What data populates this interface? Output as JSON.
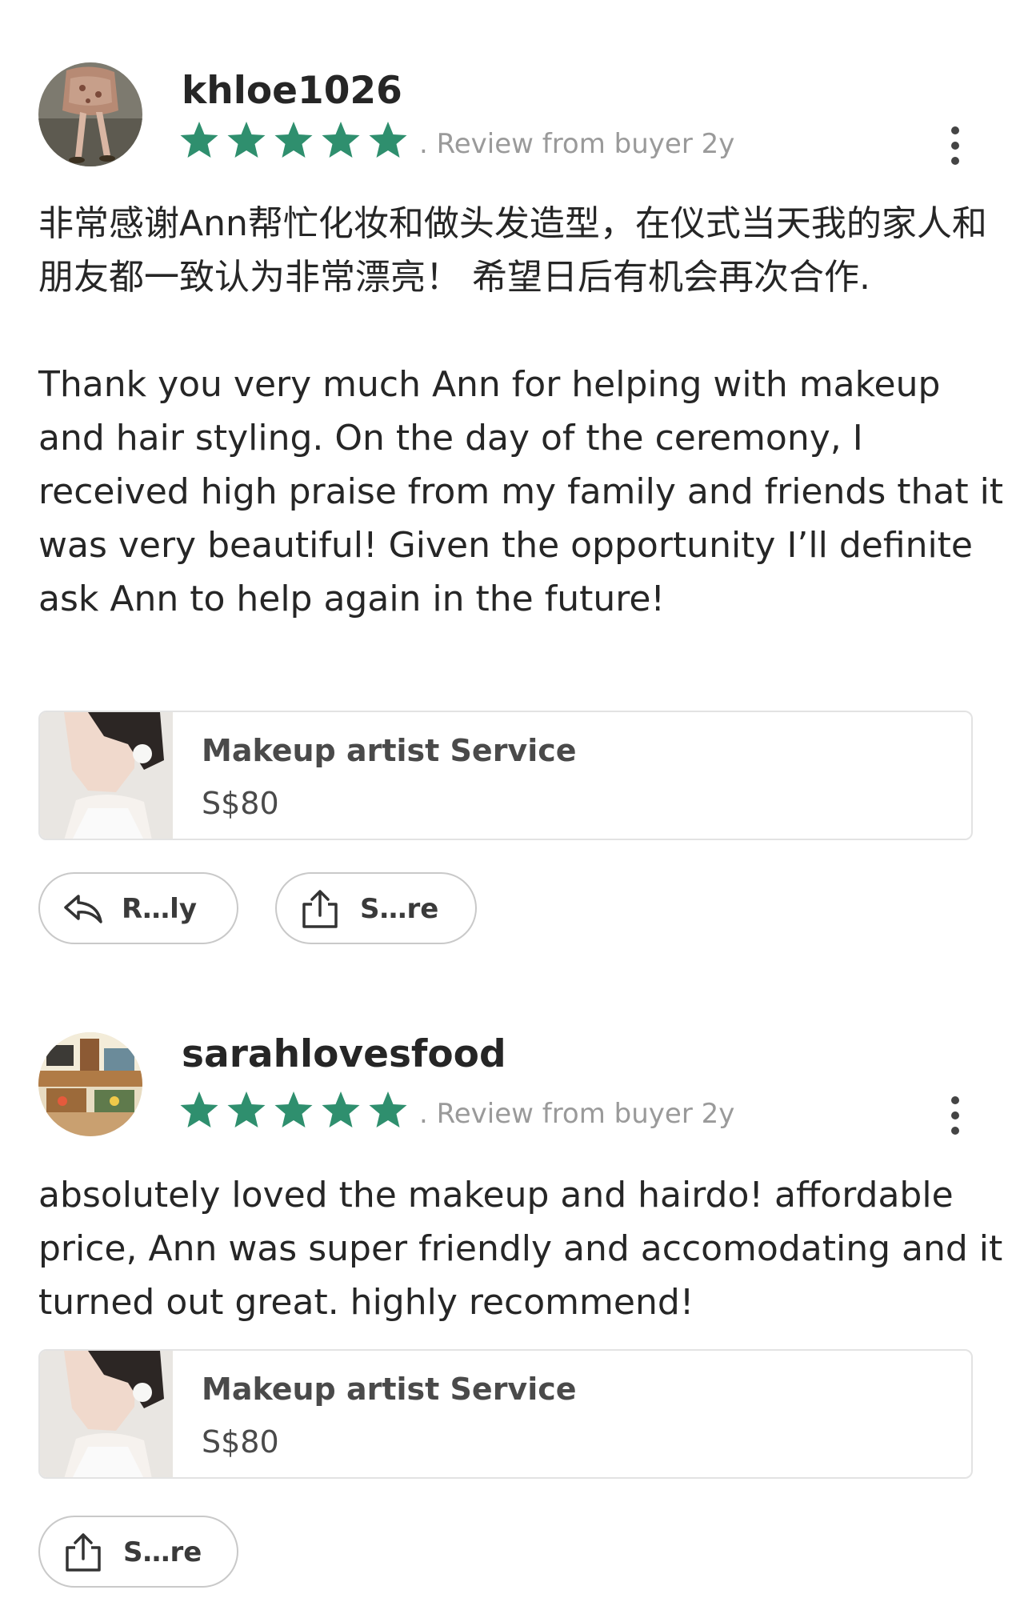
{
  "colors": {
    "star": "#2f8f6e",
    "meta_text": "#9a9a9a",
    "body_text": "#262626",
    "card_border": "#e3e3e3",
    "pill_border": "#c9c9c9"
  },
  "reviews": [
    {
      "username": "khloe1026",
      "rating": 5,
      "meta": ". Review from buyer  2y",
      "body_paragraphs": [
        "非常感谢Ann帮忙化妆和做头发造型，在仪式当天我的家人和朋友都一致认为非常漂亮！ 希望日后有机会再次合作.",
        "Thank you very much Ann for helping with makeup and hair styling. On the day of the ceremony, I received high praise from my family and friends that it was very beautiful! Given the opportunity I’ll definite ask Ann to help again in the future!"
      ],
      "product": {
        "name": "Makeup artist Service",
        "price": "S$80"
      },
      "actions": {
        "reply_label": "R…ly",
        "share_label": "S…re"
      },
      "icons": {
        "avatar": "avatar-photo",
        "more": "more-vertical-icon",
        "reply": "reply-icon",
        "share": "share-icon"
      }
    },
    {
      "username": "sarahlovesfood",
      "rating": 5,
      "meta": ". Review from buyer  2y",
      "body_paragraphs": [
        "absolutely loved the makeup and hairdo! affordable price, Ann was super friendly and accomodating and it turned out great. highly recommend!"
      ],
      "product": {
        "name": "Makeup artist Service",
        "price": "S$80"
      },
      "actions": {
        "share_label": "S…re"
      },
      "icons": {
        "avatar": "avatar-illustration",
        "more": "more-vertical-icon",
        "share": "share-icon"
      }
    }
  ]
}
